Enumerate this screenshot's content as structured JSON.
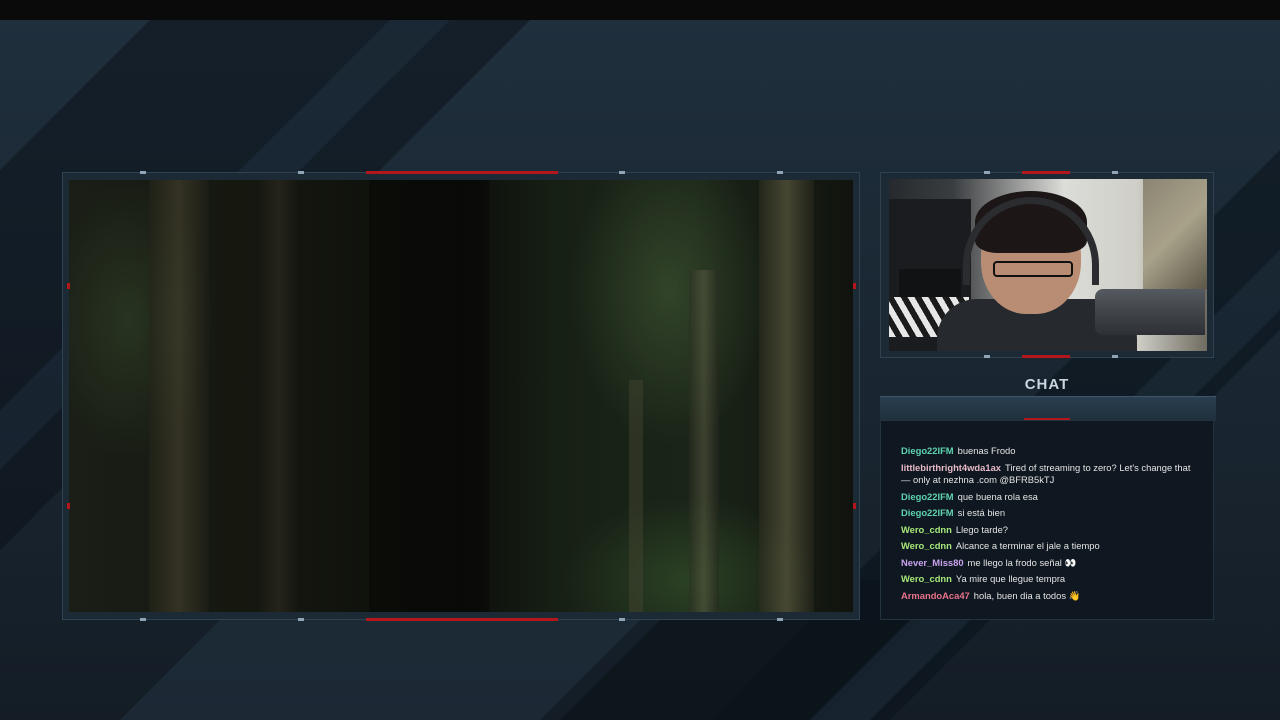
{
  "chat": {
    "title": "CHAT",
    "messages": [
      {
        "user": "Diego22IFM",
        "text": "buenas Frodo",
        "color": "#5fd3b1"
      },
      {
        "user": "littlebirthright4wda1ax",
        "text": "Tired of streaming to zero? Let's change that — only at nezhna .com @BFRB5kTJ",
        "color": "#e8b9c9"
      },
      {
        "user": "Diego22IFM",
        "text": "que buena rola esa",
        "color": "#5fd3b1"
      },
      {
        "user": "Diego22IFM",
        "text": "si está bien",
        "color": "#5fd3b1"
      },
      {
        "user": "Wero_cdnn",
        "text": "Llego tarde?",
        "color": "#a6e87a"
      },
      {
        "user": "Wero_cdnn",
        "text": "Alcance a terminar el jale a tiempo",
        "color": "#a6e87a"
      },
      {
        "user": "Never_Miss80",
        "text": "me llego la frodo señal 👀",
        "color": "#c9a2f0"
      },
      {
        "user": "Wero_cdnn",
        "text": "Ya mire que llegue tempra",
        "color": "#a6e87a"
      },
      {
        "user": "ArmandoAca47",
        "text": "hola, buen dia a todos 👋",
        "color": "#e8728a"
      }
    ]
  },
  "colors": {
    "accent": "#b3161b",
    "frame": "#1c2a36"
  }
}
